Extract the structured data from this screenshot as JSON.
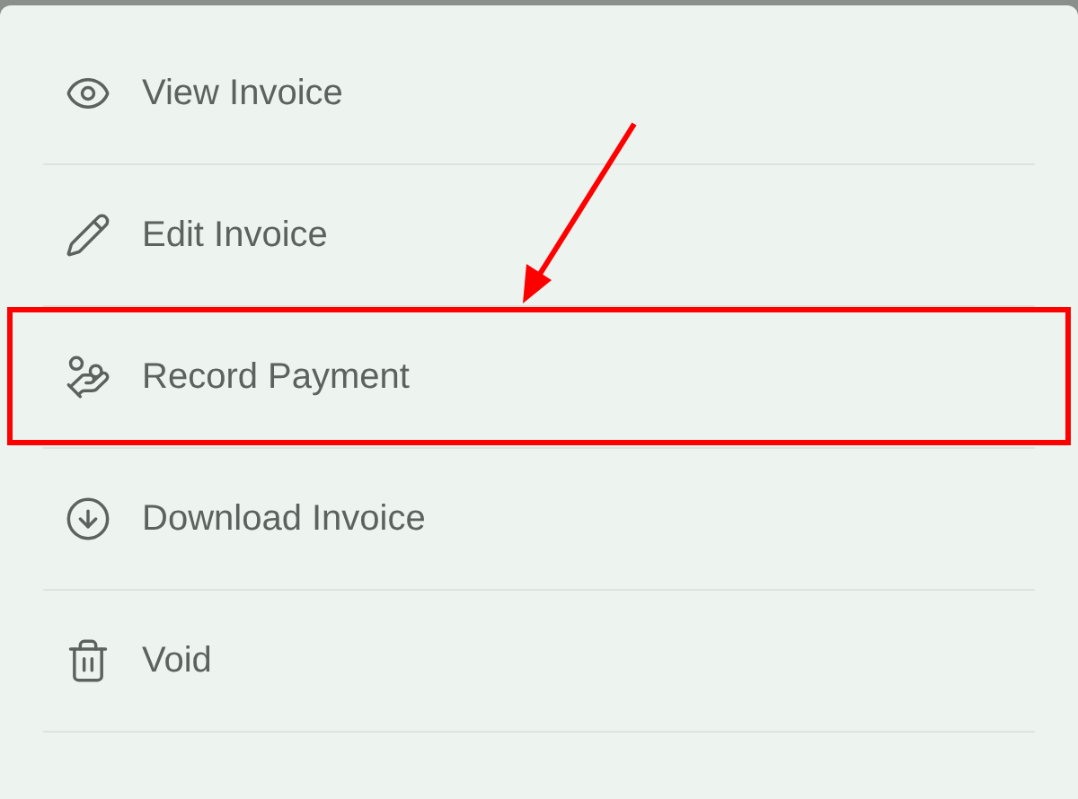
{
  "menu": {
    "items": [
      {
        "kind": "view",
        "label": "View Invoice",
        "highlighted": false
      },
      {
        "kind": "edit",
        "label": "Edit Invoice",
        "highlighted": false
      },
      {
        "kind": "payment",
        "label": "Record Payment",
        "highlighted": true
      },
      {
        "kind": "download",
        "label": "Download Invoice",
        "highlighted": false
      },
      {
        "kind": "void",
        "label": "Void",
        "highlighted": false
      }
    ]
  }
}
